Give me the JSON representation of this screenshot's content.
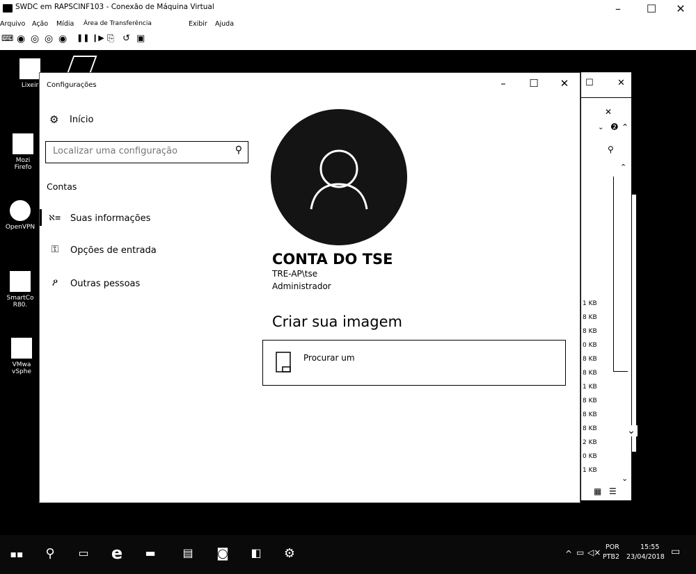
{
  "host_window": {
    "title": "SWDC em RAPSCINF103 - Conexão de Máquina Virtual",
    "controls": {
      "minimize": "–",
      "maximize": "☐",
      "close": "✕"
    },
    "menu": [
      "Arquivo",
      "Ação",
      "Mídia",
      "Área de Transferência",
      "Exibir",
      "Ajuda"
    ],
    "toolbar_icons": [
      "ctrl-alt-del-icon",
      "start-icon",
      "turn-off-icon",
      "shutdown-icon",
      "power-icon",
      "pause-icon",
      "resume-icon",
      "checkpoint-icon",
      "revert-icon",
      "enhanced-session-icon"
    ]
  },
  "desktop": {
    "icons": [
      {
        "label": "Lixeir",
        "icon": "recycle-bin-icon"
      },
      {
        "label": "Mozi Firefo",
        "icon": "firefox-icon"
      },
      {
        "label": "OpenVPN",
        "icon": "openvpn-icon"
      },
      {
        "label": "SmartCo R80.",
        "icon": "smartconsole-icon"
      },
      {
        "label": "VMwa vSphe",
        "icon": "vmware-icon"
      }
    ]
  },
  "background_window": {
    "sizes": [
      "1 KB",
      "8 KB",
      "8 KB",
      "0 KB",
      "8 KB",
      "8 KB",
      "1 KB",
      "8 KB",
      "8 KB",
      "8 KB",
      "2 KB",
      "0 KB",
      "1 KB"
    ]
  },
  "settings": {
    "title": "Configurações",
    "controls": {
      "minimize": "–",
      "maximize": "☐",
      "close": "✕"
    },
    "home": "Início",
    "search": {
      "placeholder": "Localizar uma configuração"
    },
    "section": "Contas",
    "nav": [
      {
        "label": "Suas informações",
        "icon": "person-card-icon"
      },
      {
        "label": "Opções de entrada",
        "icon": "key-icon"
      },
      {
        "label": "Outras pessoas",
        "icon": "person-add-icon"
      }
    ],
    "account": {
      "name": "CONTA DO TSE",
      "user": "TRE-AP\\tse",
      "role": "Administrador"
    },
    "create_picture": "Criar sua imagem",
    "browse": "Procurar um"
  },
  "taskbar": {
    "language_top": "POR",
    "language_bottom": "PTB2",
    "time": "15:55",
    "date": "23/04/2018",
    "colors": {
      "background": "#0a0a0a"
    }
  }
}
